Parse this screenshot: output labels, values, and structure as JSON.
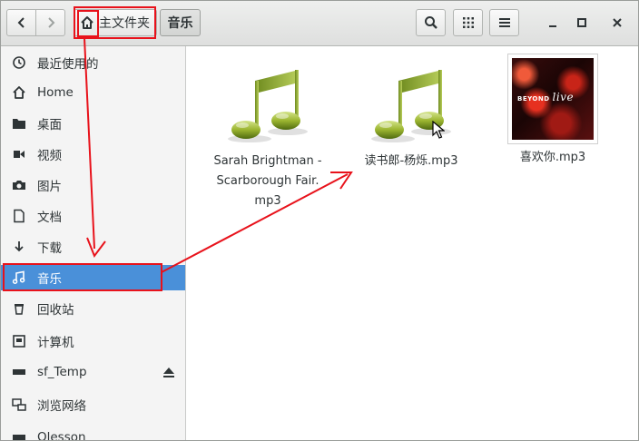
{
  "header": {
    "crumbs": [
      {
        "label": "主文件夹"
      },
      {
        "label": "音乐"
      }
    ]
  },
  "sidebar": {
    "items": [
      {
        "label": "最近使用的",
        "icon": "clock-icon"
      },
      {
        "label": "Home",
        "icon": "home-icon"
      },
      {
        "label": "桌面",
        "icon": "folder-icon"
      },
      {
        "label": "视频",
        "icon": "video-icon"
      },
      {
        "label": "图片",
        "icon": "camera-icon"
      },
      {
        "label": "文档",
        "icon": "document-icon"
      },
      {
        "label": "下载",
        "icon": "download-icon"
      },
      {
        "label": "音乐",
        "icon": "music-note-icon",
        "active": true
      },
      {
        "label": "回收站",
        "icon": "trash-icon"
      },
      {
        "label": "计算机",
        "icon": "computer-icon"
      },
      {
        "label": "sf_Temp",
        "icon": "drive-icon"
      },
      {
        "label": "浏览网络",
        "icon": "network-icon"
      },
      {
        "label": "Olesson",
        "icon": "drive-icon"
      }
    ]
  },
  "files": [
    {
      "name_lines": [
        "Sarah Brightman -",
        "Scarborough Fair.",
        "mp3"
      ],
      "icon": "music-file-icon"
    },
    {
      "name_lines": [
        "读书郎-杨烁.mp3"
      ],
      "icon": "music-file-icon"
    },
    {
      "name_lines": [
        "喜欢你.mp3"
      ],
      "icon": "album-art-thumbnail",
      "album_text": "BEYOND",
      "album_script": "live"
    }
  ],
  "colors": {
    "selection": "#4a90d9",
    "annotation": "#e8121b"
  }
}
